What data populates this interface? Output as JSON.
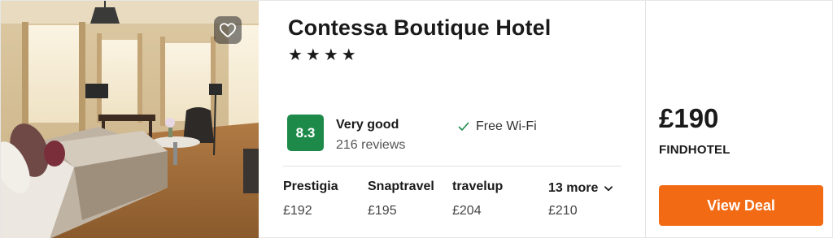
{
  "hotel": {
    "name": "Contessa Boutique Hotel",
    "stars": "★★★★",
    "star_count": 4
  },
  "rating": {
    "score": "8.3",
    "label": "Very good",
    "reviews": "216 reviews",
    "color": "#1e8a4a"
  },
  "amenity": {
    "label": "Free Wi-Fi",
    "icon": "check-icon"
  },
  "providers": [
    {
      "name": "Prestigia",
      "price": "£192"
    },
    {
      "name": "Snaptravel",
      "price": "£195"
    },
    {
      "name": "travelup",
      "price": "£204"
    }
  ],
  "more": {
    "label": "13 more",
    "price": "£210",
    "icon": "chevron-down-icon"
  },
  "best_deal": {
    "price": "£190",
    "provider": "FINDHOTEL",
    "button_label": "View Deal",
    "button_color": "#f26a14"
  },
  "favorite": {
    "icon": "heart-icon"
  }
}
